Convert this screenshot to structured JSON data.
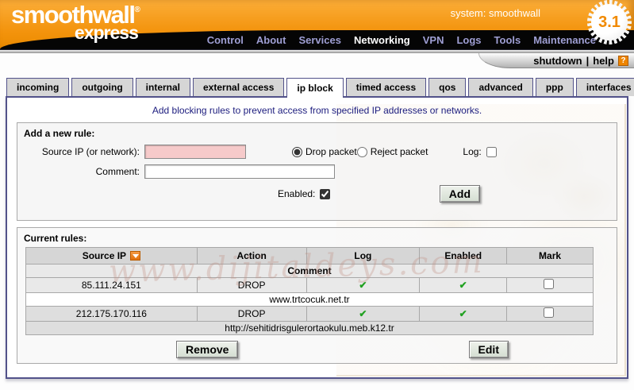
{
  "header": {
    "logo_text": "smoothwall",
    "logo_reg": "®",
    "logo_sub": "express",
    "system_label": "system: smoothwall",
    "version": "3.1",
    "nav": [
      {
        "label": "Control",
        "active": false
      },
      {
        "label": "About",
        "active": false
      },
      {
        "label": "Services",
        "active": false
      },
      {
        "label": "Networking",
        "active": true
      },
      {
        "label": "VPN",
        "active": false
      },
      {
        "label": "Logs",
        "active": false
      },
      {
        "label": "Tools",
        "active": false
      },
      {
        "label": "Maintenance",
        "active": false
      }
    ],
    "shutdown_label": "shutdown",
    "link_separator": "|",
    "help_label": "help",
    "help_icon_glyph": "?"
  },
  "tabs": [
    {
      "label": "incoming",
      "active": false
    },
    {
      "label": "outgoing",
      "active": false
    },
    {
      "label": "internal",
      "active": false
    },
    {
      "label": "external access",
      "active": false
    },
    {
      "label": "ip block",
      "active": true
    },
    {
      "label": "timed access",
      "active": false
    },
    {
      "label": "qos",
      "active": false
    },
    {
      "label": "advanced",
      "active": false
    },
    {
      "label": "ppp",
      "active": false
    },
    {
      "label": "interfaces",
      "active": false
    }
  ],
  "page": {
    "description": "Add blocking rules to prevent access from specified IP addresses or networks."
  },
  "add_rule": {
    "section_title": "Add a new rule:",
    "source_ip_label": "Source IP (or network):",
    "source_ip_value": "",
    "drop_label": "Drop packet",
    "drop_selected": true,
    "reject_label": "Reject packet",
    "reject_selected": false,
    "log_label": "Log:",
    "log_checked": false,
    "comment_label": "Comment:",
    "comment_value": "",
    "enabled_label": "Enabled:",
    "enabled_checked": true,
    "add_button": "Add"
  },
  "current_rules": {
    "section_title": "Current rules:",
    "columns": [
      "Source IP",
      "Action",
      "Log",
      "Enabled",
      "Mark"
    ],
    "sorted_column": "Source IP",
    "sort_direction": "desc",
    "comment_header": "Comment",
    "rules": [
      {
        "source_ip": "85.111.24.151",
        "action": "DROP",
        "log": true,
        "enabled": true,
        "marked": false,
        "comment": "www.trtcocuk.net.tr"
      },
      {
        "source_ip": "212.175.170.116",
        "action": "DROP",
        "log": true,
        "enabled": true,
        "marked": false,
        "comment": "http://sehitidrisgulerortaokulu.meb.k12.tr"
      }
    ],
    "remove_button": "Remove",
    "edit_button": "Edit"
  },
  "icons": {
    "check_glyph": "✔"
  },
  "watermark_text": "www.dijitaldeys.com",
  "colors": {
    "accent_orange": "#f3930c",
    "nav_link": "#9f9fd4",
    "navy_border": "#52528a",
    "description_text": "#1c1c7e",
    "check_green": "#21a121",
    "input_pink": "#f6caca",
    "badge_text": "#f18a00"
  }
}
